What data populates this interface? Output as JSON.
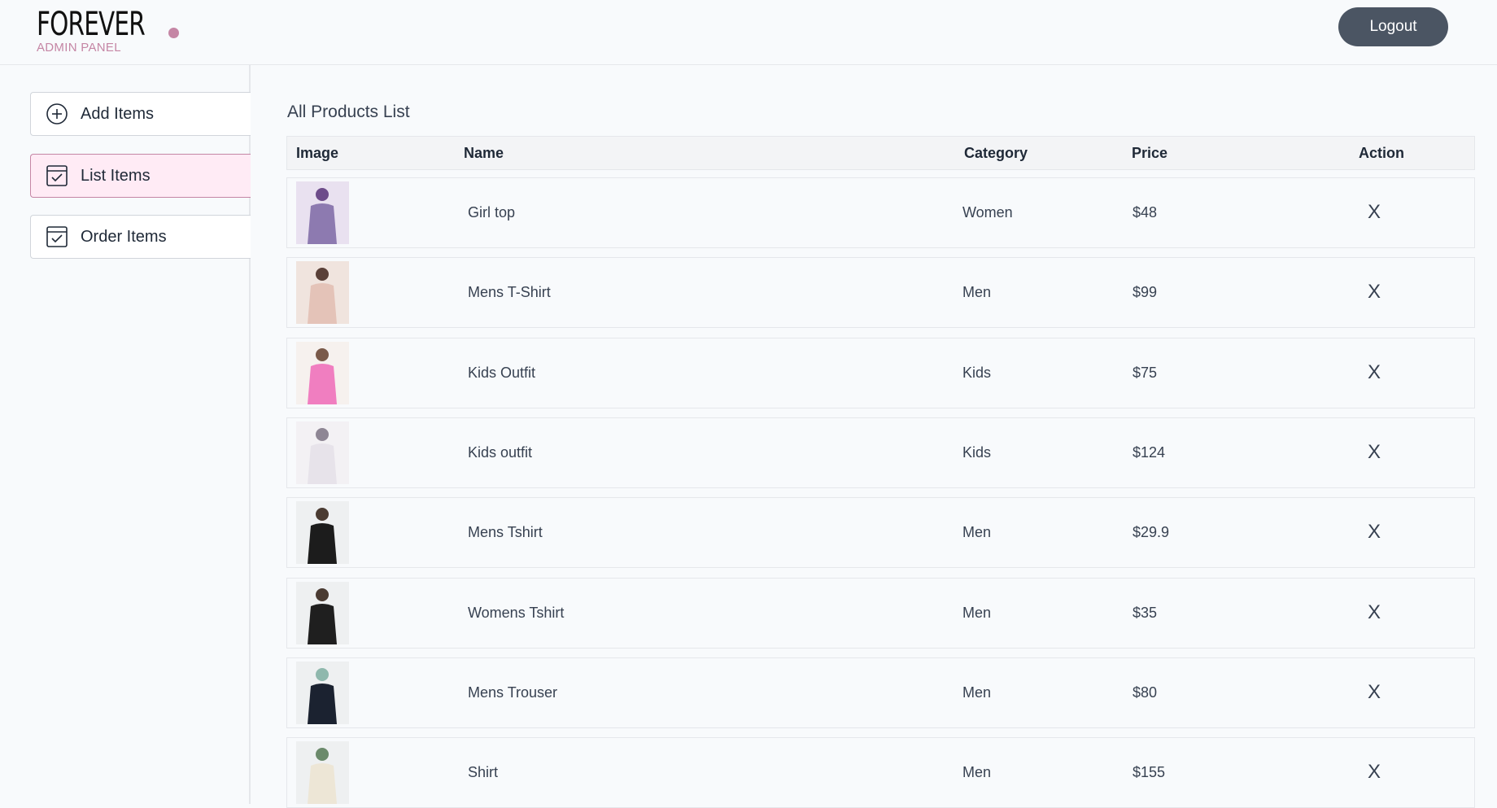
{
  "header": {
    "logo_text": "FOREVER",
    "logo_sub": "ADMIN PANEL",
    "logout_label": "Logout",
    "accent": "#c586a5"
  },
  "sidebar": {
    "items": [
      {
        "label": "Add Items",
        "icon": "plus-circle-icon"
      },
      {
        "label": "List Items",
        "icon": "checkbox-icon",
        "active": true
      },
      {
        "label": "Order Items",
        "icon": "checkbox-icon"
      }
    ]
  },
  "main": {
    "title": "All Products List",
    "columns": [
      "Image",
      "Name",
      "Category",
      "Price",
      "Action"
    ],
    "rows": [
      {
        "name": "Girl top",
        "category": "Women",
        "price": "$48",
        "action": "X",
        "thumb_colors": [
          "#8d7ab0",
          "#e9e1f0",
          "#6d4c8a"
        ]
      },
      {
        "name": "Mens T-Shirt",
        "category": "Men",
        "price": "$99",
        "action": "X",
        "thumb_colors": [
          "#e4c3b8",
          "#f0e4de",
          "#5a4038"
        ]
      },
      {
        "name": "Kids Outfit",
        "category": "Kids",
        "price": "$75",
        "action": "X",
        "thumb_colors": [
          "#f07ec0",
          "#f6f1ee",
          "#7a5a4a"
        ]
      },
      {
        "name": "Kids outfit",
        "category": "Kids",
        "price": "$124",
        "action": "X",
        "thumb_colors": [
          "#e7e3ea",
          "#f3f1f4",
          "#8e8694"
        ]
      },
      {
        "name": "Mens Tshirt",
        "category": "Men",
        "price": "$29.9",
        "action": "X",
        "thumb_colors": [
          "#1c1c1c",
          "#eef0f1",
          "#4a3b32"
        ]
      },
      {
        "name": "Womens Tshirt",
        "category": "Men",
        "price": "$35",
        "action": "X",
        "thumb_colors": [
          "#1f1f1f",
          "#eef0f1",
          "#4a3b32"
        ]
      },
      {
        "name": "Mens Trouser",
        "category": "Men",
        "price": "$80",
        "action": "X",
        "thumb_colors": [
          "#1b2230",
          "#eef0f1",
          "#8fb8ad"
        ]
      },
      {
        "name": "Shirt",
        "category": "Men",
        "price": "$155",
        "action": "X",
        "thumb_colors": [
          "#ede6d6",
          "#eef0f1",
          "#6b8a6b"
        ]
      }
    ]
  }
}
